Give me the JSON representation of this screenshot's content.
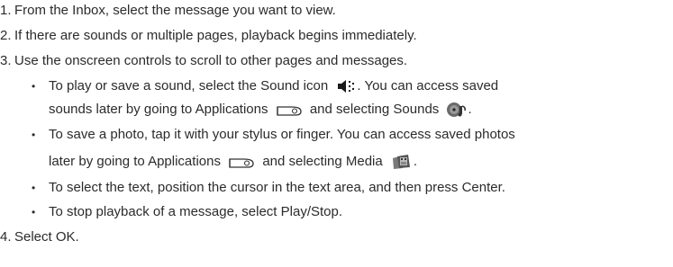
{
  "steps": [
    {
      "number": "1.",
      "text": "From the Inbox, select the message you want to view."
    },
    {
      "number": "2.",
      "text": "If there are sounds or multiple pages, playback begins immediately."
    },
    {
      "number": "3.",
      "text": "Use the onscreen controls to scroll to other pages and messages."
    },
    {
      "number": "4.",
      "text": "Select OK."
    }
  ],
  "bullets": {
    "marker": "•",
    "sound": {
      "line1_a": "To play or save a sound, select the Sound icon",
      "line1_b": ". You can access saved",
      "line2_a": "sounds later by going to Applications",
      "line2_b": "and selecting Sounds",
      "line2_c": "."
    },
    "photo": {
      "line1": "To save a photo, tap it with your stylus or finger. You can access saved photos",
      "line2_a": "later by going to Applications",
      "line2_b": "and selecting Media",
      "line2_c": "."
    },
    "text_select": "To select the text, position the cursor in the text area, and then press Center.",
    "stop": "To stop playback of a message, select Play/Stop."
  },
  "icons": {
    "sound_icon": "speaker-sound-icon",
    "applications_icon": "applications-icon",
    "sounds_app_icon": "sounds-app-icon",
    "media_app_icon": "media-app-icon"
  }
}
